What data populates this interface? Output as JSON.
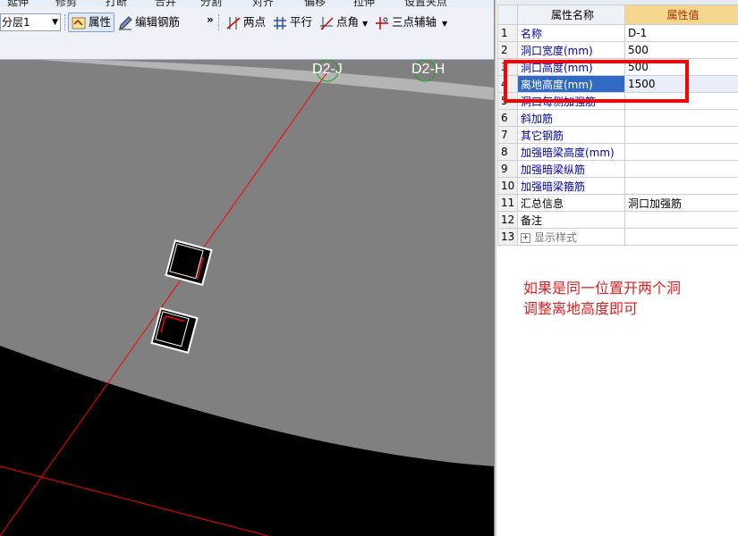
{
  "top_strip": [
    "延伸",
    "修剪",
    "打断",
    "合并",
    "分割",
    "对齐",
    "偏移",
    "拉伸",
    "设置夹点"
  ],
  "toolbar": {
    "floor_select": "分层1",
    "buttons": {
      "properties": "属性",
      "edit_rebar": "编辑钢筋",
      "two_point": "两点",
      "parallel": "平行",
      "point_angle": "点角",
      "three_point_axis": "三点辅轴"
    },
    "more": "»"
  },
  "canvas": {
    "axis_labels": [
      "D2-J",
      "D2-H"
    ],
    "colors": {
      "background": "#000000",
      "wall": "#808080",
      "wall_edge": "#b4b4b4",
      "axis_line": "#ff0000",
      "axis_circle": "#1aa01a"
    }
  },
  "property_panel": {
    "headers": {
      "name": "属性名称",
      "value": "属性值"
    },
    "rows": [
      {
        "num": "1",
        "name": "名称",
        "value": "D-1"
      },
      {
        "num": "2",
        "name": "洞口宽度(mm)",
        "value": "500"
      },
      {
        "num": "3",
        "name": "洞口高度(mm)",
        "value": "500"
      },
      {
        "num": "4",
        "name": "离地高度(mm)",
        "value": "1500"
      },
      {
        "num": "5",
        "name": "洞口每侧加强筋",
        "value": ""
      },
      {
        "num": "6",
        "name": "斜加筋",
        "value": ""
      },
      {
        "num": "7",
        "name": "其它钢筋",
        "value": ""
      },
      {
        "num": "8",
        "name": "加强暗梁高度(mm)",
        "value": ""
      },
      {
        "num": "9",
        "name": "加强暗梁纵筋",
        "value": ""
      },
      {
        "num": "10",
        "name": "加强暗梁箍筋",
        "value": ""
      },
      {
        "num": "11",
        "name": "汇总信息",
        "value": "洞口加强筋"
      },
      {
        "num": "12",
        "name": "备注",
        "value": ""
      },
      {
        "num": "13",
        "name": "显示样式",
        "value": "",
        "expander": "+"
      }
    ]
  },
  "annotation": {
    "line1": "如果是同一位置开两个洞",
    "line2": "调整离地高度即可",
    "color": "#e02020"
  }
}
